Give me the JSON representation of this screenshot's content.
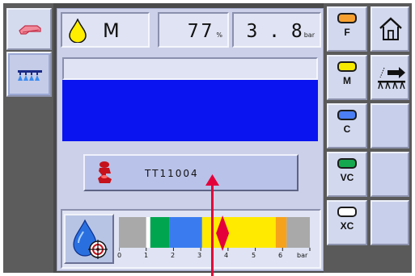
{
  "status": {
    "tip_class": "M",
    "percent_value": "77",
    "percent_unit": "%",
    "pressure_value": "3 . 8",
    "pressure_unit": "bar"
  },
  "nozzle": {
    "label": "TT11004"
  },
  "pressure_scale": {
    "ticks": [
      "0",
      "1",
      "2",
      "3",
      "4",
      "5",
      "6",
      "bar"
    ],
    "current_value": 3.8,
    "min": 0,
    "max": 7,
    "bands": [
      {
        "from": 0.0,
        "to": 1.0,
        "color": "#a9a9a9"
      },
      {
        "from": 1.0,
        "to": 1.15,
        "color": "#ffffff"
      },
      {
        "from": 1.15,
        "to": 1.85,
        "color": "#00a64f"
      },
      {
        "from": 1.85,
        "to": 3.05,
        "color": "#3a7cf0"
      },
      {
        "from": 3.05,
        "to": 5.75,
        "color": "#ffea00"
      },
      {
        "from": 5.75,
        "to": 6.15,
        "color": "#f7a21b"
      },
      {
        "from": 6.15,
        "to": 7.0,
        "color": "#a9a9a9"
      }
    ]
  },
  "right_buttons": [
    {
      "label": "F",
      "color": "#f7a030"
    },
    {
      "label": "M",
      "color": "#f5ea00"
    },
    {
      "label": "C",
      "color": "#4a7ef2"
    },
    {
      "label": "VC",
      "color": "#16a84f"
    },
    {
      "label": "XC",
      "color": "#ffffff"
    }
  ],
  "colors": {
    "accent_red": "#e4003b",
    "display_blue": "#0a14f0"
  }
}
